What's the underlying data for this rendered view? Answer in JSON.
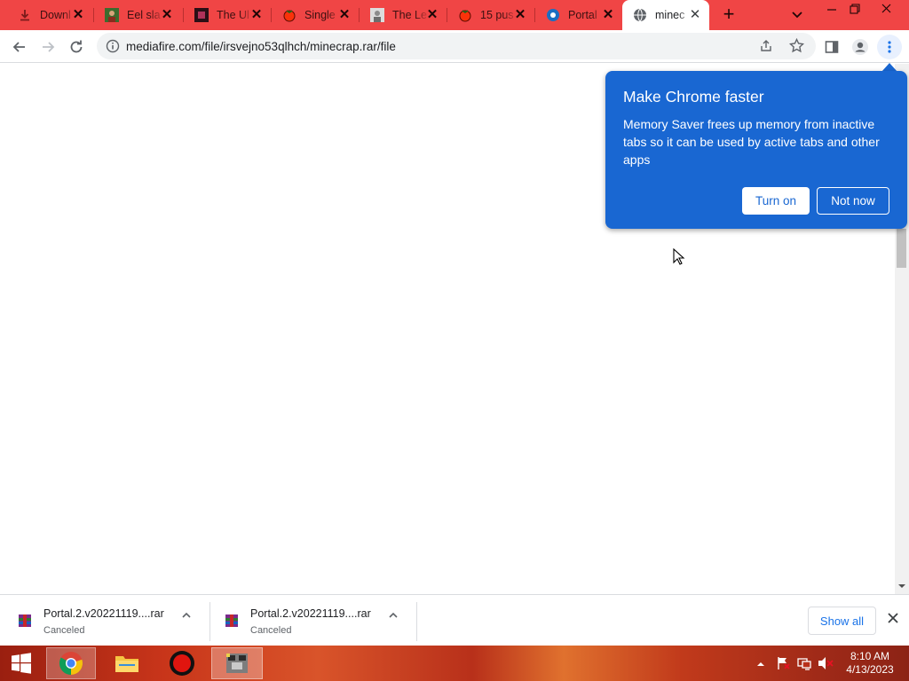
{
  "tabs": [
    {
      "title": "Downl",
      "favicon": "download-icon"
    },
    {
      "title": "Eel sla",
      "favicon": "person-photo-icon"
    },
    {
      "title": "The Ul",
      "favicon": "square-logo-icon"
    },
    {
      "title": "Single",
      "favicon": "tomato-icon"
    },
    {
      "title": "The Le",
      "favicon": "person-photo-icon"
    },
    {
      "title": "15 pus",
      "favicon": "tomato-icon"
    },
    {
      "title": "Portal",
      "favicon": "steam-icon"
    },
    {
      "title": "minec",
      "favicon": "globe-icon",
      "active": true
    }
  ],
  "new_tab_label": "+",
  "address_bar": {
    "url": "mediafire.com/file/irsvejno53qlhch/minecrap.rar/file"
  },
  "bubble": {
    "title": "Make Chrome faster",
    "body": "Memory Saver frees up memory from inactive tabs so it can be used by active tabs and other apps",
    "primary_button": "Turn on",
    "secondary_button": "Not now"
  },
  "downloads": [
    {
      "filename": "Portal.2.v20221119....rar",
      "status": "Canceled"
    },
    {
      "filename": "Portal.2.v20221119....rar",
      "status": "Canceled"
    }
  ],
  "show_all_label": "Show all",
  "taskbar": {
    "time": "8:10 AM",
    "date": "4/13/2023"
  },
  "colors": {
    "tab_strip": "#f04545",
    "bubble": "#1967d2",
    "link": "#1a73e8"
  }
}
